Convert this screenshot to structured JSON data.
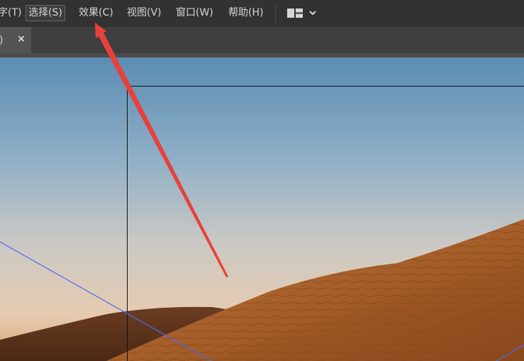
{
  "menubar": {
    "items": [
      {
        "label": "字(T)"
      },
      {
        "label": "选择(S)"
      },
      {
        "label": "效果(C)"
      },
      {
        "label": "视图(V)"
      },
      {
        "label": "窗口(W)"
      },
      {
        "label": "帮助(H)"
      }
    ],
    "workspace_icon": "workspace-layout-icon",
    "dropdown_icon": "chevron-down-icon"
  },
  "tabbar": {
    "tab_label": ")",
    "close_glyph": "×"
  },
  "canvas": {
    "image": "desert-dunes-photo",
    "annotation": "red-arrow-pointing-to-effect-menu",
    "colors": {
      "sky_top": "#5c8db2",
      "sky_bottom": "#e0cdb6",
      "dune": "#a55d2a",
      "arrow": "#e8413c",
      "guide": "#4a6cf0"
    }
  }
}
